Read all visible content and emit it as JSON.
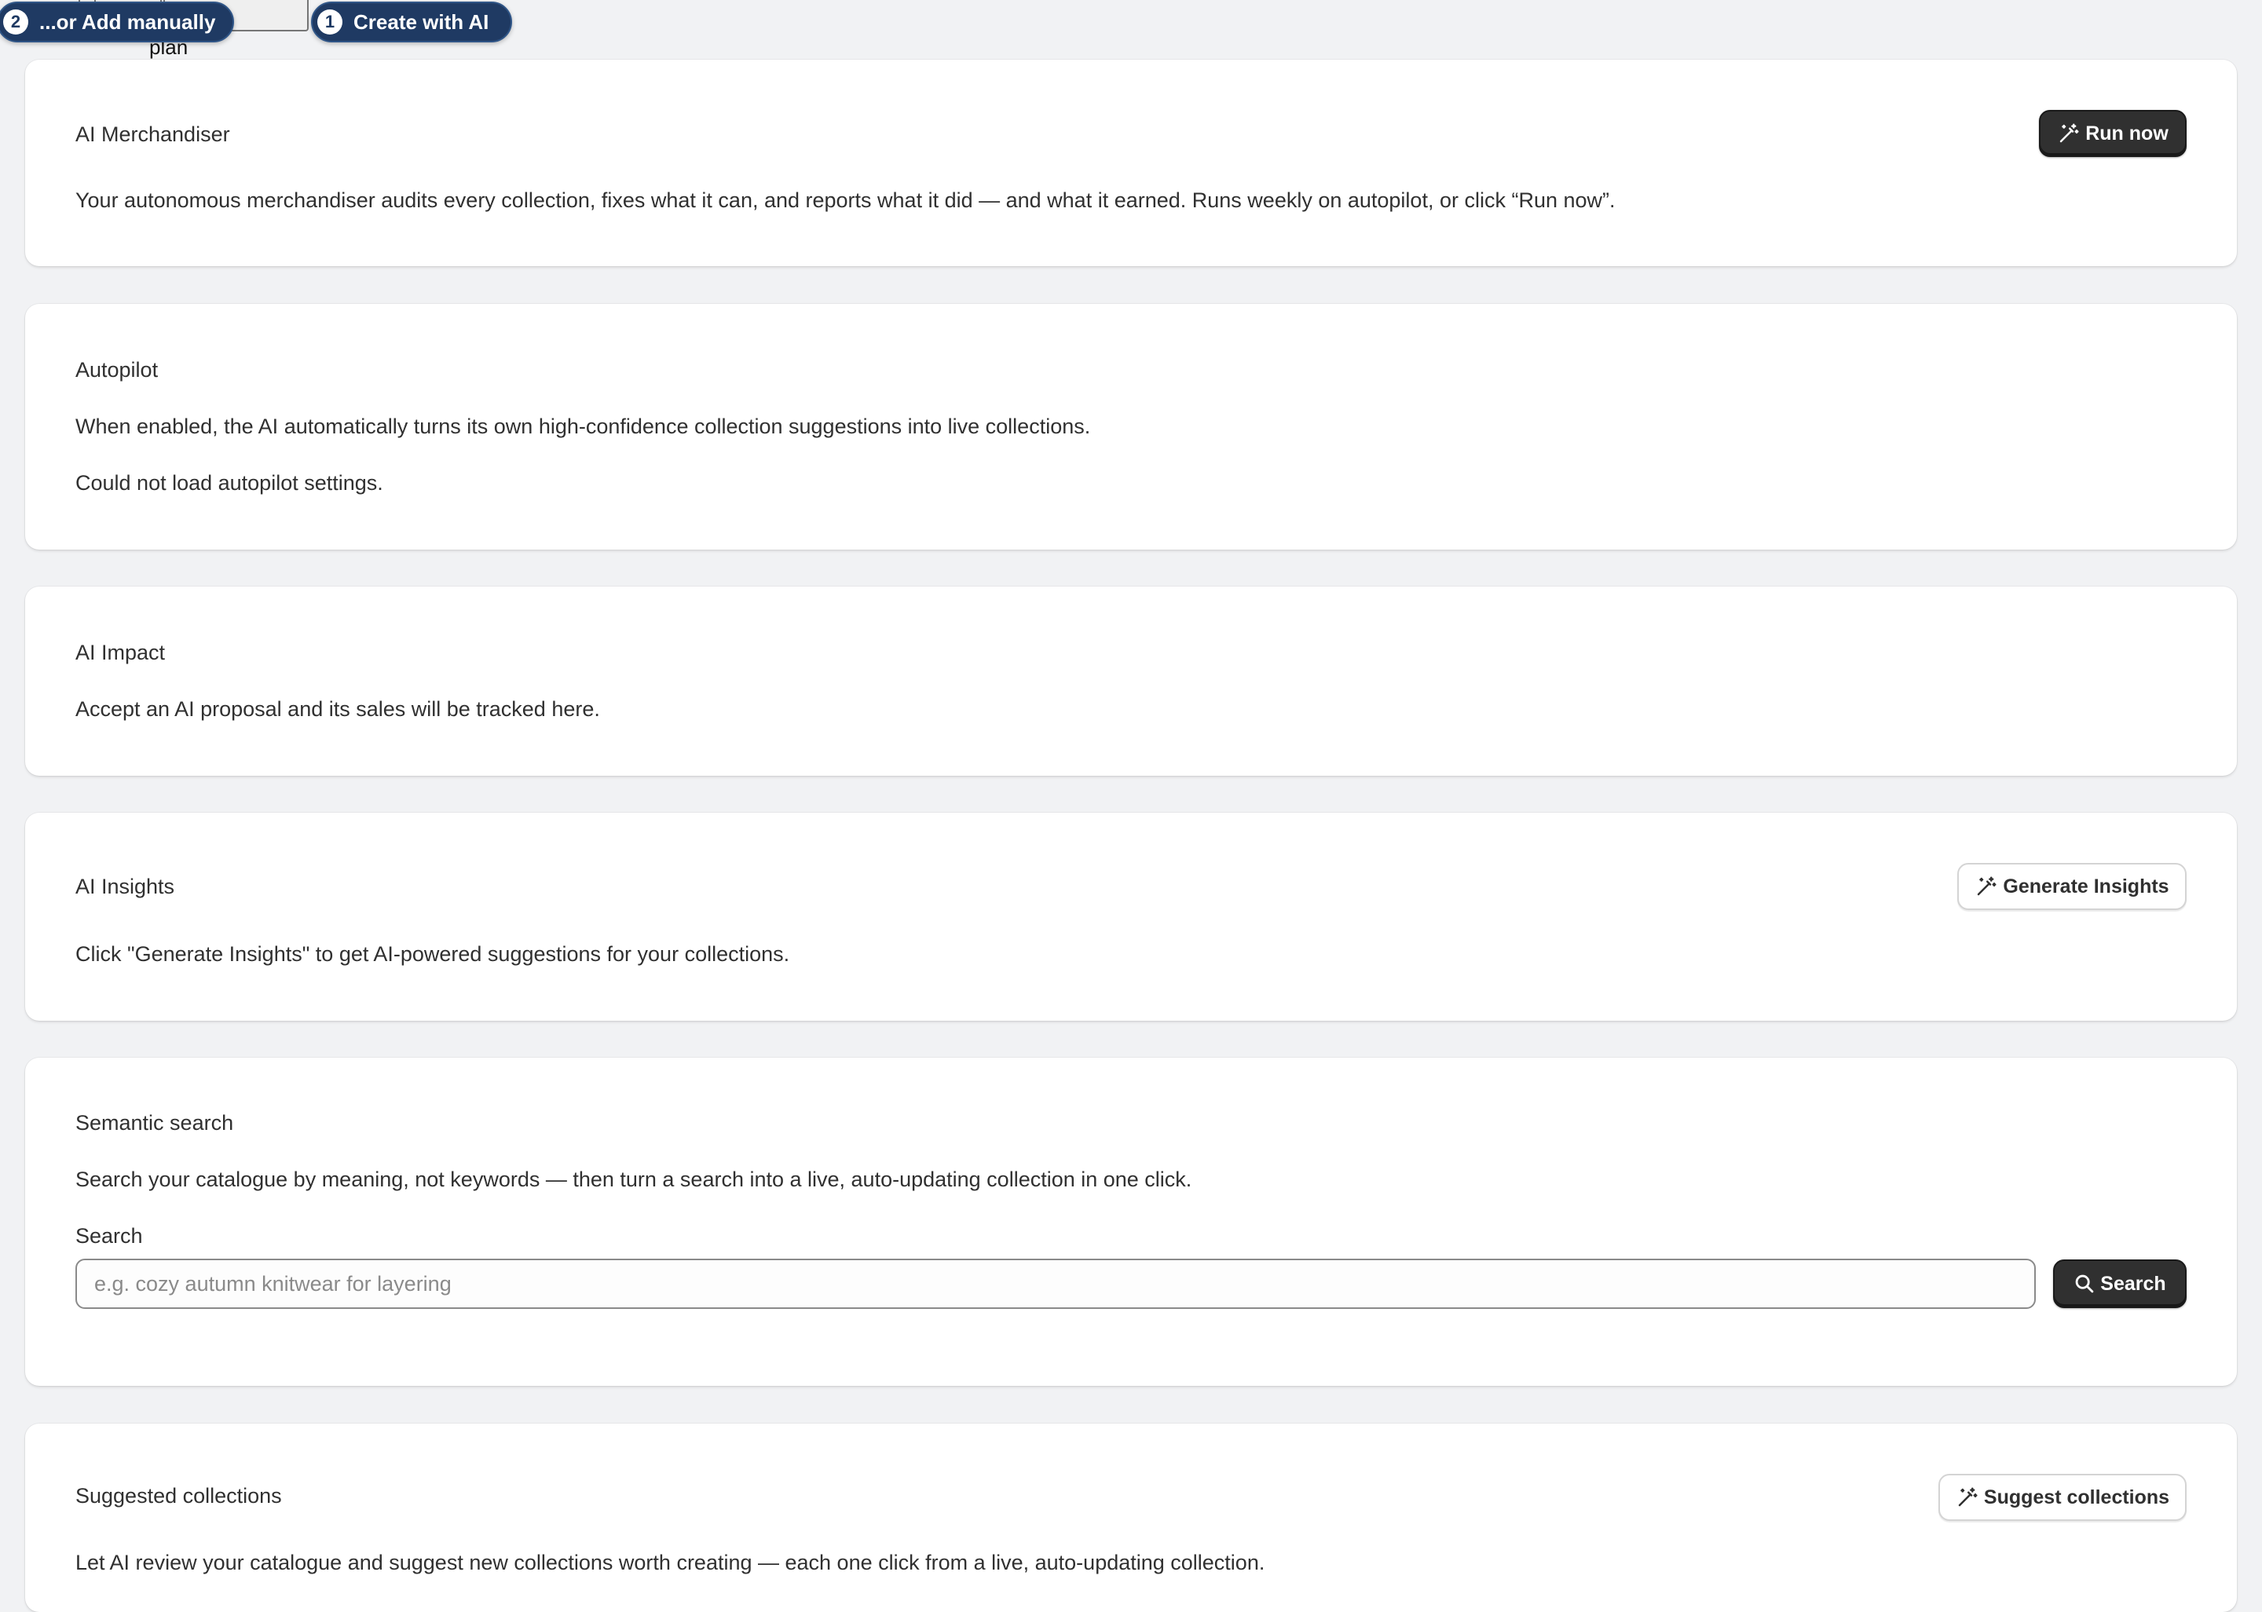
{
  "overlay": {
    "partial_button_left": "",
    "partial_button_text": "ge plan",
    "partial_button_right": "",
    "tour_step_2": {
      "number": "2",
      "label": "...or Add manually"
    },
    "tour_step_1": {
      "number": "1",
      "label": "Create with AI"
    }
  },
  "merchandiser": {
    "title": "AI Merchandiser",
    "description": "Your autonomous merchandiser audits every collection, fixes what it can, and reports what it did — and what it earned. Runs weekly on autopilot, or click “Run now”.",
    "run_button": "Run now",
    "run_icon": "magic-wand-icon"
  },
  "autopilot": {
    "title": "Autopilot",
    "description": "When enabled, the AI automatically turns its own high-confidence collection suggestions into live collections.",
    "error": "Could not load autopilot settings."
  },
  "impact": {
    "title": "AI Impact",
    "description": "Accept an AI proposal and its sales will be tracked here."
  },
  "insights": {
    "title": "AI Insights",
    "description": "Click \"Generate Insights\" to get AI-powered suggestions for your collections.",
    "generate_button": "Generate Insights",
    "generate_icon": "magic-wand-icon"
  },
  "semantic_search": {
    "title": "Semantic search",
    "description": "Search your catalogue by meaning, not keywords — then turn a search into a live, auto-updating collection in one click.",
    "search_label": "Search",
    "search_placeholder": "e.g. cozy autumn knitwear for layering",
    "search_value": "",
    "search_button": "Search",
    "search_icon": "search-icon"
  },
  "suggested": {
    "title": "Suggested collections",
    "description": "Let AI review your catalogue and suggest new collections worth creating — each one click from a live, auto-updating collection.",
    "suggest_button": "Suggest collections",
    "suggest_icon": "magic-wand-icon"
  }
}
